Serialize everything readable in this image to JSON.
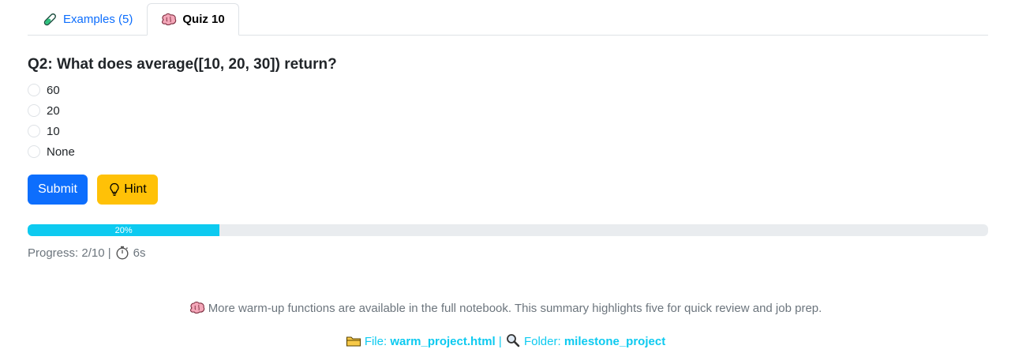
{
  "tabs": [
    {
      "label": "Examples (5)",
      "icon": "test-tube-icon",
      "active": false
    },
    {
      "label": "Quiz 10",
      "icon": "brain-icon",
      "active": true
    }
  ],
  "question": {
    "prefix": "Q2:",
    "text": "What does average([10, 20, 30]) return?",
    "options": [
      "60",
      "20",
      "10",
      "None"
    ]
  },
  "buttons": {
    "submit_label": "Submit",
    "hint_label": "Hint"
  },
  "progress": {
    "percent": 20,
    "bar_label": "20%",
    "text": "Progress: 2/10 |",
    "timer": "6s"
  },
  "footer": {
    "note": "More warm-up functions are available in the full notebook. This summary highlights five for quick review and job prep.",
    "file_label": "File:",
    "file_name": "warm_project.html",
    "separator": "|",
    "folder_label": "Folder:",
    "folder_name": "milestone_project"
  },
  "colors": {
    "primary": "#0d6efd",
    "warning": "#ffc107",
    "info": "#0dcaf0",
    "muted": "#6c757d"
  }
}
